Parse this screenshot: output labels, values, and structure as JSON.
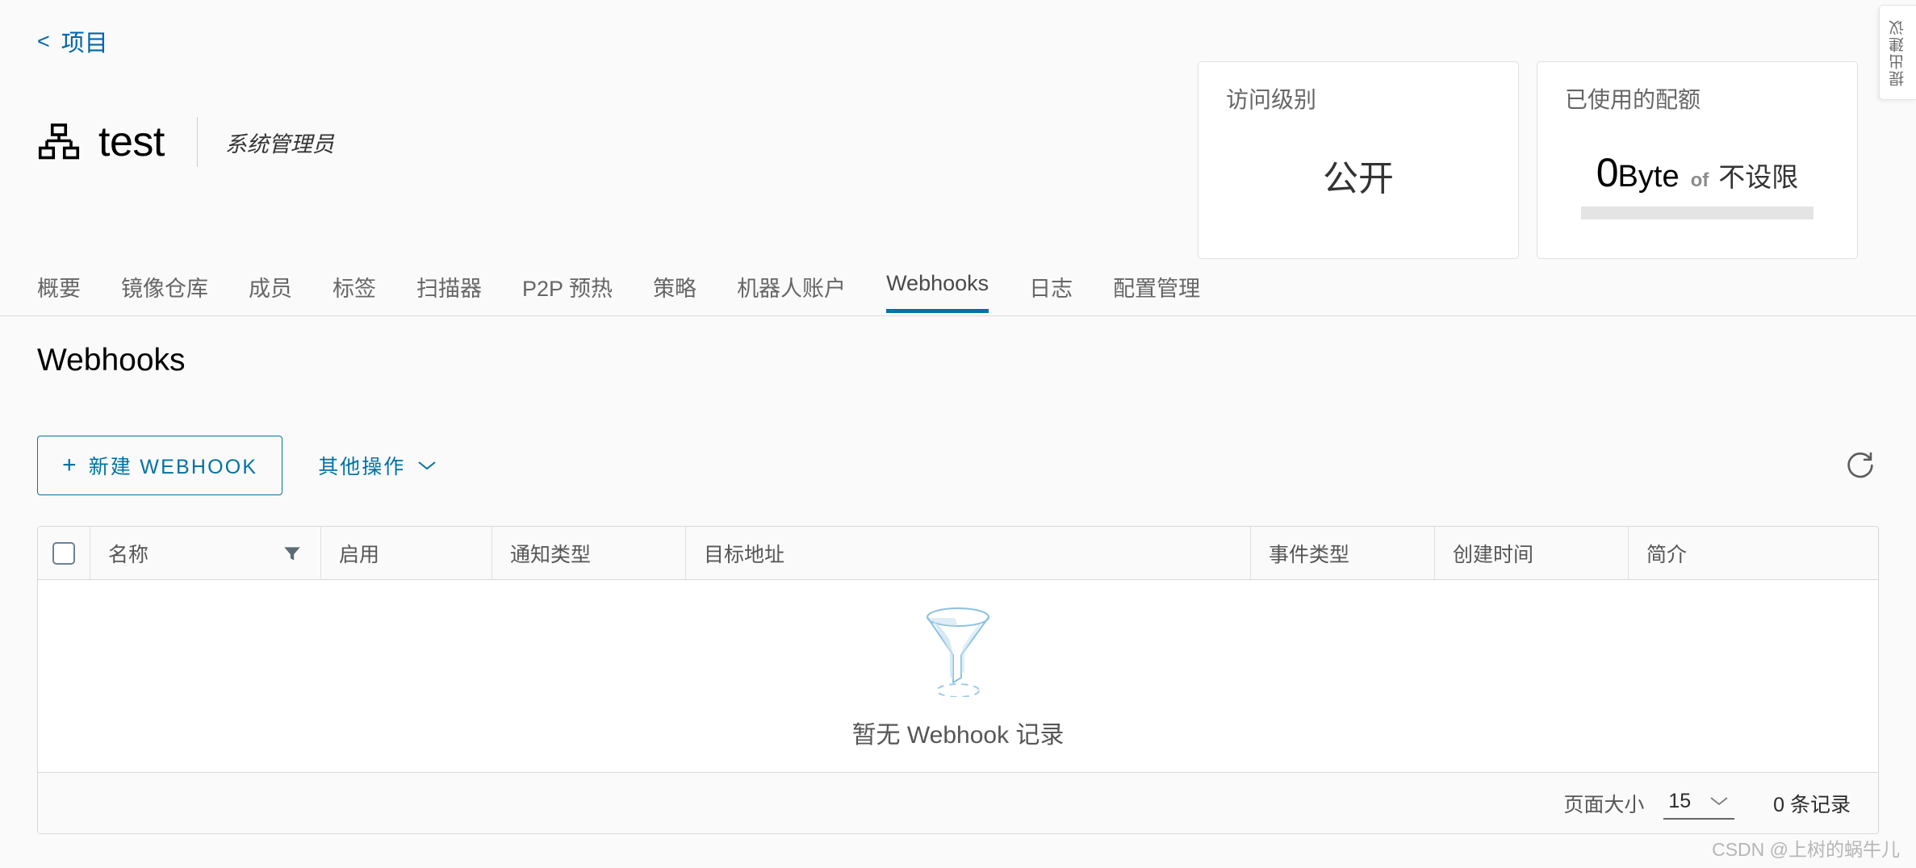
{
  "breadcrumb": {
    "back_icon": "chevron-left-icon",
    "label": "项目"
  },
  "project": {
    "icon": "org-hierarchy-icon",
    "name": "test",
    "role": "系统管理员"
  },
  "cards": [
    {
      "title": "访问级别",
      "value": "公开"
    }
  ],
  "quota_card": {
    "title": "已使用的配额",
    "used_number": "0",
    "used_unit": "Byte",
    "of": "of",
    "limit": "不设限",
    "progress_percent": 0
  },
  "side_tab": {
    "label": "提出建议"
  },
  "tabs": [
    {
      "label": "概要",
      "active": false
    },
    {
      "label": "镜像仓库",
      "active": false
    },
    {
      "label": "成员",
      "active": false
    },
    {
      "label": "标签",
      "active": false
    },
    {
      "label": "扫描器",
      "active": false
    },
    {
      "label": "P2P 预热",
      "active": false
    },
    {
      "label": "策略",
      "active": false
    },
    {
      "label": "机器人账户",
      "active": false
    },
    {
      "label": "Webhooks",
      "active": true
    },
    {
      "label": "日志",
      "active": false
    },
    {
      "label": "配置管理",
      "active": false
    }
  ],
  "page": {
    "title": "Webhooks"
  },
  "toolbar": {
    "new_webhook_label": "新建 WEBHOOK",
    "new_webhook_icon": "plus-icon",
    "more_actions_label": "其他操作",
    "more_actions_icon": "chevron-down-icon",
    "refresh_icon": "refresh-icon"
  },
  "table": {
    "columns": [
      {
        "label": "名称",
        "filter": true
      },
      {
        "label": "启用",
        "filter": false
      },
      {
        "label": "通知类型",
        "filter": false
      },
      {
        "label": "目标地址",
        "filter": false
      },
      {
        "label": "事件类型",
        "filter": false
      },
      {
        "label": "创建时间",
        "filter": false
      },
      {
        "label": "简介",
        "filter": false
      }
    ],
    "rows": [],
    "empty": {
      "icon": "funnel-empty-icon",
      "text": "暂无 Webhook 记录"
    },
    "footer": {
      "page_size_label": "页面大小",
      "page_size_value": "15",
      "page_size_icon": "chevron-down-icon",
      "total_label": "0 条记录"
    }
  },
  "colors": {
    "accent": "#0072a3",
    "link": "#0065ab",
    "empty_icon": "#a8cfe8",
    "page_bg": "#fafafa"
  },
  "watermark": "CSDN @上树的蜗牛儿"
}
